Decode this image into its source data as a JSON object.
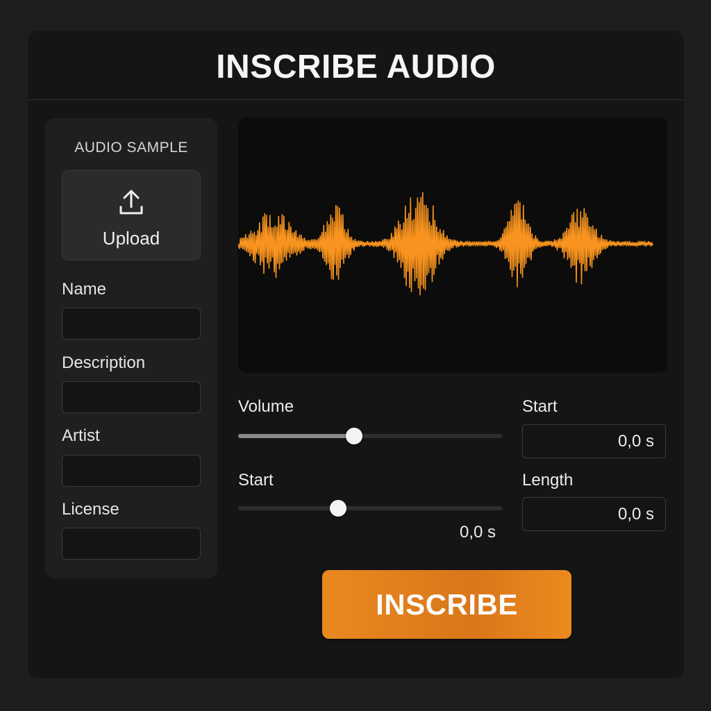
{
  "header": {
    "title": "INSCRIBE AUDIO"
  },
  "sidebar": {
    "title": "AUDIO SAMPLE",
    "upload": {
      "label": "Upload",
      "icon": "upload-icon"
    },
    "fields": [
      {
        "label": "Name",
        "value": ""
      },
      {
        "label": "Description",
        "value": ""
      },
      {
        "label": "Artist",
        "value": ""
      },
      {
        "label": "License",
        "value": ""
      }
    ]
  },
  "waveform": {
    "color": "#f7931e",
    "background": "#0c0c0c"
  },
  "controls": {
    "volume": {
      "label": "Volume",
      "level_percent": 44
    },
    "start_slider": {
      "label": "Start",
      "level_percent": 38,
      "value": "0,0 s"
    },
    "start_field": {
      "label": "Start",
      "value": "0,0 s"
    },
    "length_field": {
      "label": "Length",
      "value": "0,0 s"
    }
  },
  "action": {
    "label": "INSCRIBE",
    "color": "#e9891f"
  }
}
